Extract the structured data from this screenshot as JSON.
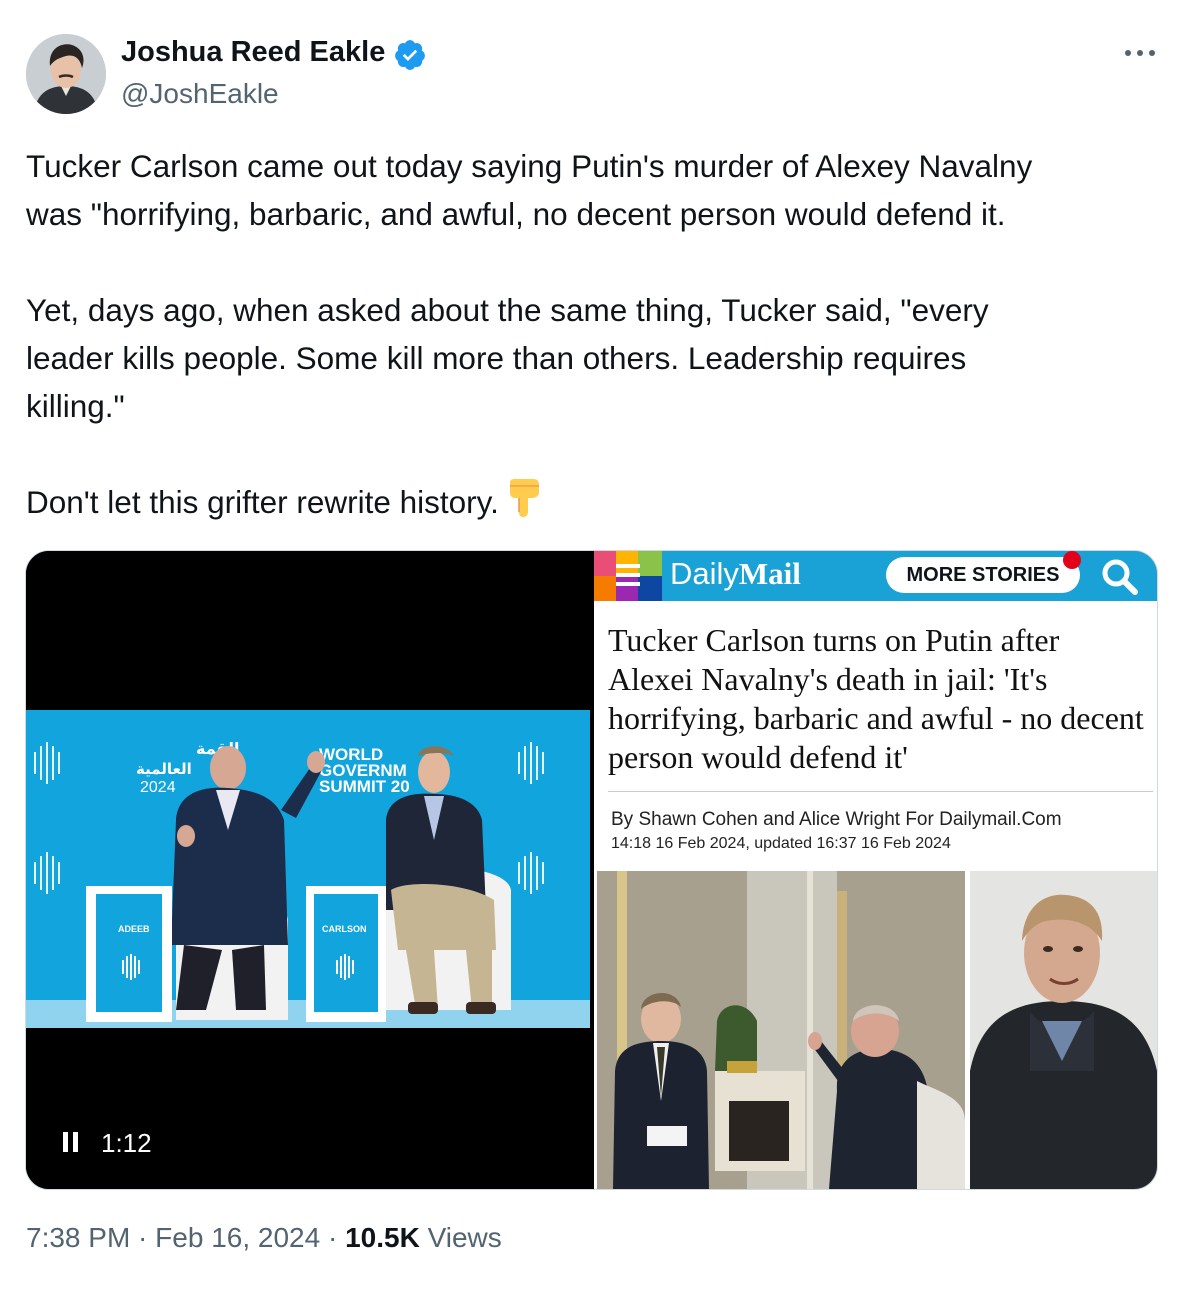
{
  "author": {
    "name": "Joshua Reed Eakle",
    "handle": "@JoshEakle",
    "verified_icon": "verified-badge-icon",
    "verified_color": "#1d9bf0"
  },
  "tweet": {
    "paragraph1": "Tucker Carlson came out today saying Putin's murder of Alexey Navalny\nwas \"horrifying, barbaric, and awful, no decent person would defend it.",
    "paragraph2": "Yet, days ago, when asked about the same thing, Tucker said, \"every\nleader kills people. Some kill more than others. Leadership requires\nkilling.\"",
    "paragraph3": "Don't let this grifter rewrite history.",
    "emoji": "backhand-index-pointing-down"
  },
  "video": {
    "duration": "1:12",
    "state_icon": "pause-icon",
    "stage_text": {
      "arabic_line1": "القمة",
      "arabic_line2": "العالمية",
      "year": "2024",
      "summit_line1": "WORLD",
      "summit_line2": "GOVERNM",
      "summit_line3": "SUMMIT 20",
      "podium_left": "ADEEB",
      "podium_right": "CARLSON"
    }
  },
  "article": {
    "brand_part1": "Daily",
    "brand_part2": "Mail",
    "more_stories": "MORE STORIES",
    "headline": "Tucker Carlson turns on Putin after Alexei Navalny's death in jail: 'It's horrifying, barbaric and awful - no decent person would defend it'",
    "byline": "By Shawn Cohen and Alice Wright For Dailymail.Com",
    "dateline": "14:18 16 Feb 2024, updated 16:37 16 Feb 2024",
    "bar_color": "#1aa2d6"
  },
  "meta": {
    "time": "7:38 PM",
    "separator": " · ",
    "date": "Feb 16, 2024",
    "views_count": "10.5K",
    "views_label": "Views"
  }
}
